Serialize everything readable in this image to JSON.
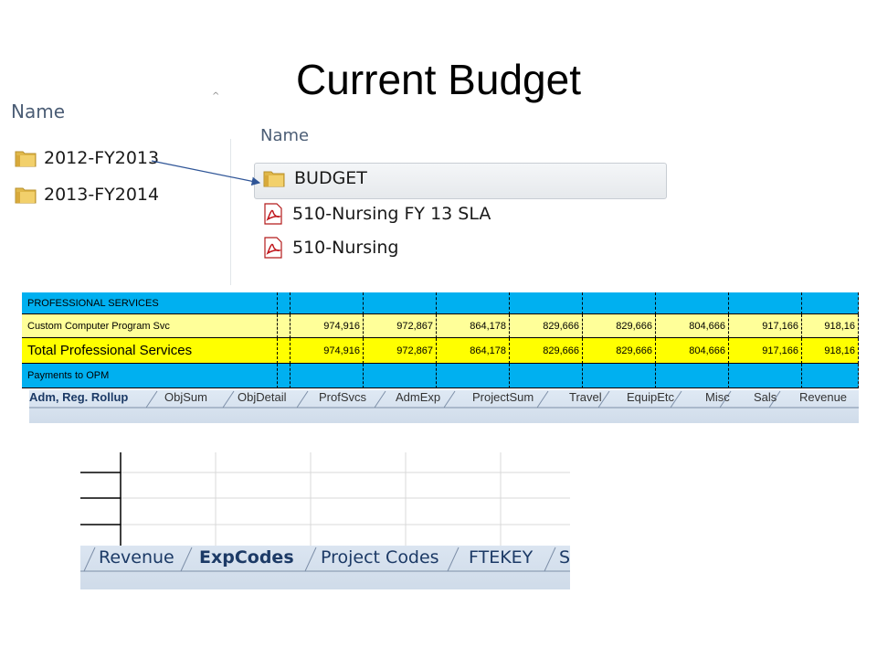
{
  "title": "Current Budget",
  "left_explorer": {
    "column_header": "Name",
    "items": [
      {
        "label": "2012-FY2013"
      },
      {
        "label": "2013-FY2014"
      }
    ]
  },
  "right_explorer": {
    "column_header": "Name",
    "items": [
      {
        "label": "BUDGET",
        "type": "folder"
      },
      {
        "label": "510-Nursing FY 13 SLA",
        "type": "pdf"
      },
      {
        "label": "510-Nursing",
        "type": "pdf"
      }
    ]
  },
  "spreadsheet": {
    "rows": [
      {
        "label": "PROFESSIONAL SERVICES",
        "values": [
          "",
          "",
          "",
          "",
          "",
          "",
          "",
          ""
        ]
      },
      {
        "label": "Custom Computer Program Svc",
        "values": [
          "974,916",
          "972,867",
          "864,178",
          "829,666",
          "829,666",
          "804,666",
          "917,166",
          "918,16"
        ]
      },
      {
        "label": "Total Professional Services",
        "values": [
          "974,916",
          "972,867",
          "864,178",
          "829,666",
          "829,666",
          "804,666",
          "917,166",
          "918,16"
        ]
      },
      {
        "label": "Payments to OPM",
        "values": [
          "",
          "",
          "",
          "",
          "",
          "",
          "",
          ""
        ]
      }
    ],
    "tabs": [
      {
        "label": "Adm, Reg. Rollup",
        "active": true
      },
      {
        "label": "ObjSum"
      },
      {
        "label": "ObjDetail"
      },
      {
        "label": "ProfSvcs"
      },
      {
        "label": "AdmExp"
      },
      {
        "label": "ProjectSum"
      },
      {
        "label": "Travel"
      },
      {
        "label": "EquipEtc"
      },
      {
        "label": "Misc"
      },
      {
        "label": "Sals"
      },
      {
        "label": "Revenue"
      }
    ]
  },
  "lower_sheet": {
    "tabs": [
      {
        "label": "Revenue"
      },
      {
        "label": "ExpCodes",
        "active": true
      },
      {
        "label": "Project Codes"
      },
      {
        "label": "FTEKEY"
      },
      {
        "label": "S"
      }
    ]
  },
  "colors": {
    "cyan_row": "#00b0f0",
    "yellow_light": "#ffff99",
    "yellow_total": "#ffff00",
    "arrow": "#2f5597"
  }
}
